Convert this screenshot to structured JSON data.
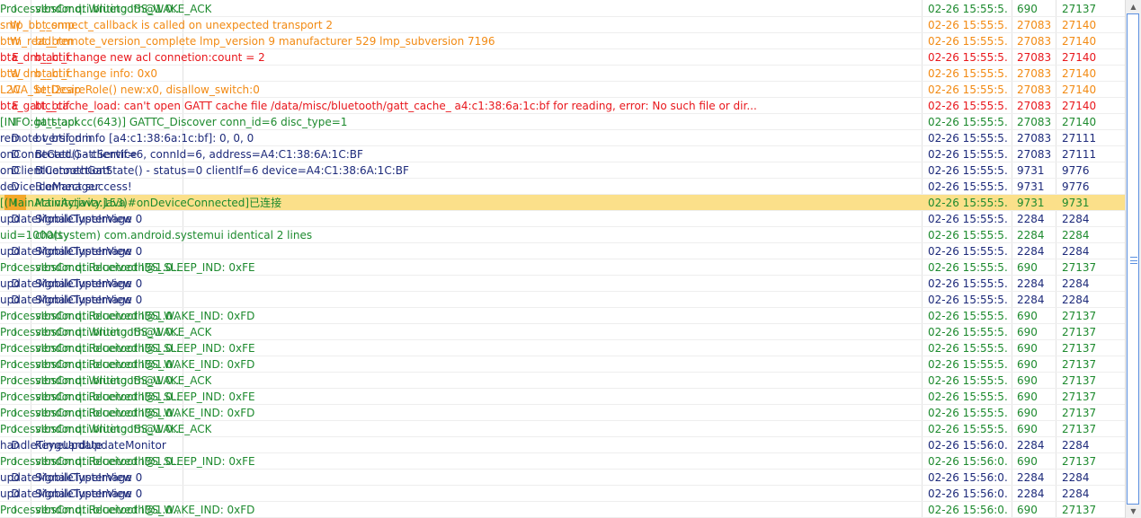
{
  "colors": {
    "I": "#1d8a2e",
    "W": "#f28a13",
    "E": "#e8171c",
    "D": "#1d2a7a",
    "selected_row_bg": "#fbe08a",
    "selected_level_bg": "#f4a82a"
  },
  "scrollbar": {
    "up_icon": "▲",
    "down_icon": "▼",
    "thumb_position": 0.98
  },
  "rows": [
    {
      "level": "I",
      "tag": "vendor.qti.bluetooth@1.0...",
      "message": "ProcessIbsCmd: Writing IBS_WAKE_ACK",
      "time": "02-26 15:55:5...",
      "pid": "690",
      "tid": "27137"
    },
    {
      "level": "W",
      "tag": "bt_smp",
      "message": "smp_br_connect_callback is called on unexpected transport 2",
      "time": "02-26 15:55:5...",
      "pid": "27083",
      "tid": "27140"
    },
    {
      "level": "W",
      "tag": "bt_btm",
      "message": "btm_read_remote_version_complete lmp_version 9 manufacturer 529 lmp_subversion 7196",
      "time": "02-26 15:55:5...",
      "pid": "27083",
      "tid": "27140"
    },
    {
      "level": "E",
      "tag": "bt_btif",
      "message": "bta_dm_acl_change new acl connetion:count = 2",
      "time": "02-26 15:55:5...",
      "pid": "27083",
      "tid": "27140"
    },
    {
      "level": "W",
      "tag": "bt_btif",
      "message": "bta_dm_acl_change info: 0x0",
      "time": "02-26 15:55:5...",
      "pid": "27083",
      "tid": "27140"
    },
    {
      "level": "W",
      "tag": "bt_l2cap",
      "message": "L2CA_SetDesireRole() new:x0, disallow_switch:0",
      "time": "02-26 15:55:5...",
      "pid": "27083",
      "tid": "27140"
    },
    {
      "level": "E",
      "tag": "bt_btif",
      "message": "bta_gattc_cache_load: can't open GATT cache file /data/misc/bluetooth/gatt_cache_ a4:c1:38:6a:1c:bf for reading, error: No such file or dir...",
      "time": "02-26 15:55:5...",
      "pid": "27083",
      "tid": "27140"
    },
    {
      "level": "I",
      "tag": "bt_stack",
      "message": "[INFO:gatt_api.cc(643)] GATTC_Discover conn_id=6 disc_type=1",
      "time": "02-26 15:55:5...",
      "pid": "27083",
      "tid": "27140"
    },
    {
      "level": "D",
      "tag": "bt_btif_dm",
      "message": "remote version info [a4:c1:38:6a:1c:bf]: 0, 0, 0",
      "time": "02-26 15:55:5...",
      "pid": "27083",
      "tid": "27111"
    },
    {
      "level": "D",
      "tag": "BtGatt.GattService",
      "message": "onConnected() - clientIf=6, connId=6, address=A4:C1:38:6A:1C:BF",
      "time": "02-26 15:55:5...",
      "pid": "27083",
      "tid": "27111"
    },
    {
      "level": "D",
      "tag": "BluetoothGatt",
      "message": "onClientConnectionState() - status=0 clientIf=6 device=A4:C1:38:6A:1C:BF",
      "time": "02-26 15:55:5...",
      "pid": "9731",
      "tid": "9776"
    },
    {
      "level": "D",
      "tag": "BleManager",
      "message": "device connect success!",
      "time": "02-26 15:55:5...",
      "pid": "9731",
      "tid": "9776"
    },
    {
      "level": "I",
      "tag": "MainActivity.java",
      "message": "[(MainActivity.java:153)#onDeviceConnected]已连接",
      "time": "02-26 15:55:5...",
      "pid": "9731",
      "tid": "9731",
      "selected": true
    },
    {
      "level": "D",
      "tag": "SignalClusterView",
      "message": "updateMobileTypeImage 0",
      "time": "02-26 15:55:5...",
      "pid": "2284",
      "tid": "2284"
    },
    {
      "level": "I",
      "tag": "chatty",
      "message": "uid=1000(system) com.android.systemui identical 2 lines",
      "time": "02-26 15:55:5...",
      "pid": "2284",
      "tid": "2284"
    },
    {
      "level": "D",
      "tag": "SignalClusterView",
      "message": "updateMobileTypeImage 0",
      "time": "02-26 15:55:5...",
      "pid": "2284",
      "tid": "2284"
    },
    {
      "level": "I",
      "tag": "vendor.qti.bluetooth@1.0...",
      "message": "ProcessIbsCmd: Received IBS_SLEEP_IND: 0xFE",
      "time": "02-26 15:55:5...",
      "pid": "690",
      "tid": "27137"
    },
    {
      "level": "D",
      "tag": "SignalClusterView",
      "message": "updateMobileTypeImage 0",
      "time": "02-26 15:55:5...",
      "pid": "2284",
      "tid": "2284"
    },
    {
      "level": "D",
      "tag": "SignalClusterView",
      "message": "updateMobileTypeImage 0",
      "time": "02-26 15:55:5...",
      "pid": "2284",
      "tid": "2284"
    },
    {
      "level": "I",
      "tag": "vendor.qti.bluetooth@1.0...",
      "message": "ProcessIbsCmd: Received IBS_WAKE_IND: 0xFD",
      "time": "02-26 15:55:5...",
      "pid": "690",
      "tid": "27137"
    },
    {
      "level": "I",
      "tag": "vendor.qti.bluetooth@1.0...",
      "message": "ProcessIbsCmd: Writing IBS_WAKE_ACK",
      "time": "02-26 15:55:5...",
      "pid": "690",
      "tid": "27137"
    },
    {
      "level": "I",
      "tag": "vendor.qti.bluetooth@1.0...",
      "message": "ProcessIbsCmd: Received IBS_SLEEP_IND: 0xFE",
      "time": "02-26 15:55:5...",
      "pid": "690",
      "tid": "27137"
    },
    {
      "level": "I",
      "tag": "vendor.qti.bluetooth@1.0...",
      "message": "ProcessIbsCmd: Received IBS_WAKE_IND: 0xFD",
      "time": "02-26 15:55:5...",
      "pid": "690",
      "tid": "27137"
    },
    {
      "level": "I",
      "tag": "vendor.qti.bluetooth@1.0...",
      "message": "ProcessIbsCmd: Writing IBS_WAKE_ACK",
      "time": "02-26 15:55:5...",
      "pid": "690",
      "tid": "27137"
    },
    {
      "level": "I",
      "tag": "vendor.qti.bluetooth@1.0...",
      "message": "ProcessIbsCmd: Received IBS_SLEEP_IND: 0xFE",
      "time": "02-26 15:55:5...",
      "pid": "690",
      "tid": "27137"
    },
    {
      "level": "I",
      "tag": "vendor.qti.bluetooth@1.0...",
      "message": "ProcessIbsCmd: Received IBS_WAKE_IND: 0xFD",
      "time": "02-26 15:55:5...",
      "pid": "690",
      "tid": "27137"
    },
    {
      "level": "I",
      "tag": "vendor.qti.bluetooth@1.0...",
      "message": "ProcessIbsCmd: Writing IBS_WAKE_ACK",
      "time": "02-26 15:55:5...",
      "pid": "690",
      "tid": "27137"
    },
    {
      "level": "D",
      "tag": "KeyguardUpdateMonitor",
      "message": "handleTimeUpdate",
      "time": "02-26 15:56:0...",
      "pid": "2284",
      "tid": "2284"
    },
    {
      "level": "I",
      "tag": "vendor.qti.bluetooth@1.0...",
      "message": "ProcessIbsCmd: Received IBS_SLEEP_IND: 0xFE",
      "time": "02-26 15:56:0...",
      "pid": "690",
      "tid": "27137"
    },
    {
      "level": "D",
      "tag": "SignalClusterView",
      "message": "updateMobileTypeImage 0",
      "time": "02-26 15:56:0...",
      "pid": "2284",
      "tid": "2284"
    },
    {
      "level": "D",
      "tag": "SignalClusterView",
      "message": "updateMobileTypeImage 0",
      "time": "02-26 15:56:0...",
      "pid": "2284",
      "tid": "2284"
    },
    {
      "level": "I",
      "tag": "vendor.qti.bluetooth@1.0...",
      "message": "ProcessIbsCmd: Received IBS_WAKE_IND: 0xFD",
      "time": "02-26 15:56:0...",
      "pid": "690",
      "tid": "27137"
    }
  ]
}
